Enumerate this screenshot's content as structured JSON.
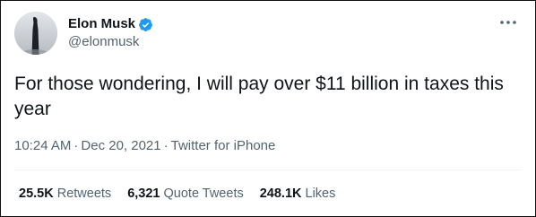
{
  "author": {
    "display_name": "Elon Musk",
    "handle": "@elonmusk",
    "verified": true,
    "verified_color": "#1d9bf0"
  },
  "tweet": {
    "text": "For those wondering, I will pay over $11 billion in taxes this year",
    "time": "10:24 AM",
    "date": "Dec 20, 2021",
    "source": "Twitter for iPhone",
    "separator": "·"
  },
  "stats": {
    "retweets": {
      "count": "25.5K",
      "label": "Retweets"
    },
    "quote_tweets": {
      "count": "6,321",
      "label": "Quote Tweets"
    },
    "likes": {
      "count": "248.1K",
      "label": "Likes"
    }
  },
  "icons": {
    "more": "more-horizontal-icon",
    "verified": "verified-badge-icon"
  },
  "colors": {
    "text_primary": "#0f1419",
    "text_secondary": "#536471",
    "divider": "#eff3f4"
  }
}
